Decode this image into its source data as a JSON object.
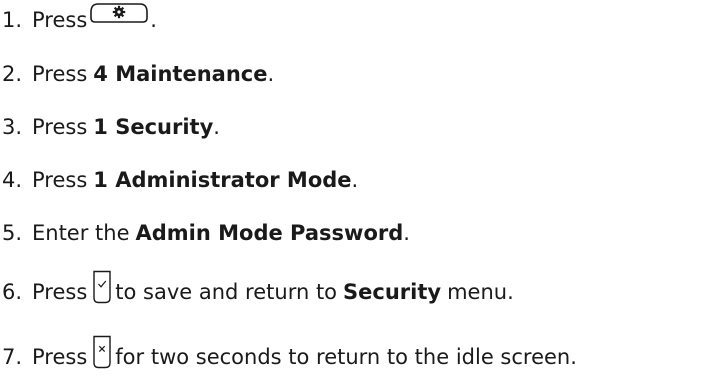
{
  "steps": [
    {
      "num": "1.",
      "pre": "Press",
      "icon": "settings-gear-key-icon",
      "post": "."
    },
    {
      "num": "2.",
      "pre": "Press",
      "bold": "4 Maintenance",
      "post": "."
    },
    {
      "num": "3.",
      "pre": "Press",
      "bold": "1 Security",
      "post": "."
    },
    {
      "num": "4.",
      "pre": "Press",
      "bold": "1 Administrator Mode",
      "post": "."
    },
    {
      "num": "5.",
      "pre": "Enter the",
      "bold": "Admin Mode Password",
      "post": "."
    },
    {
      "num": "6.",
      "pre": "Press",
      "icon": "check-key-icon",
      "mid": "to save and return to",
      "bold": "Security",
      "post": "menu."
    },
    {
      "num": "7.",
      "pre": "Press",
      "icon": "cancel-key-icon",
      "mid": "for two seconds to return to the idle screen."
    }
  ]
}
